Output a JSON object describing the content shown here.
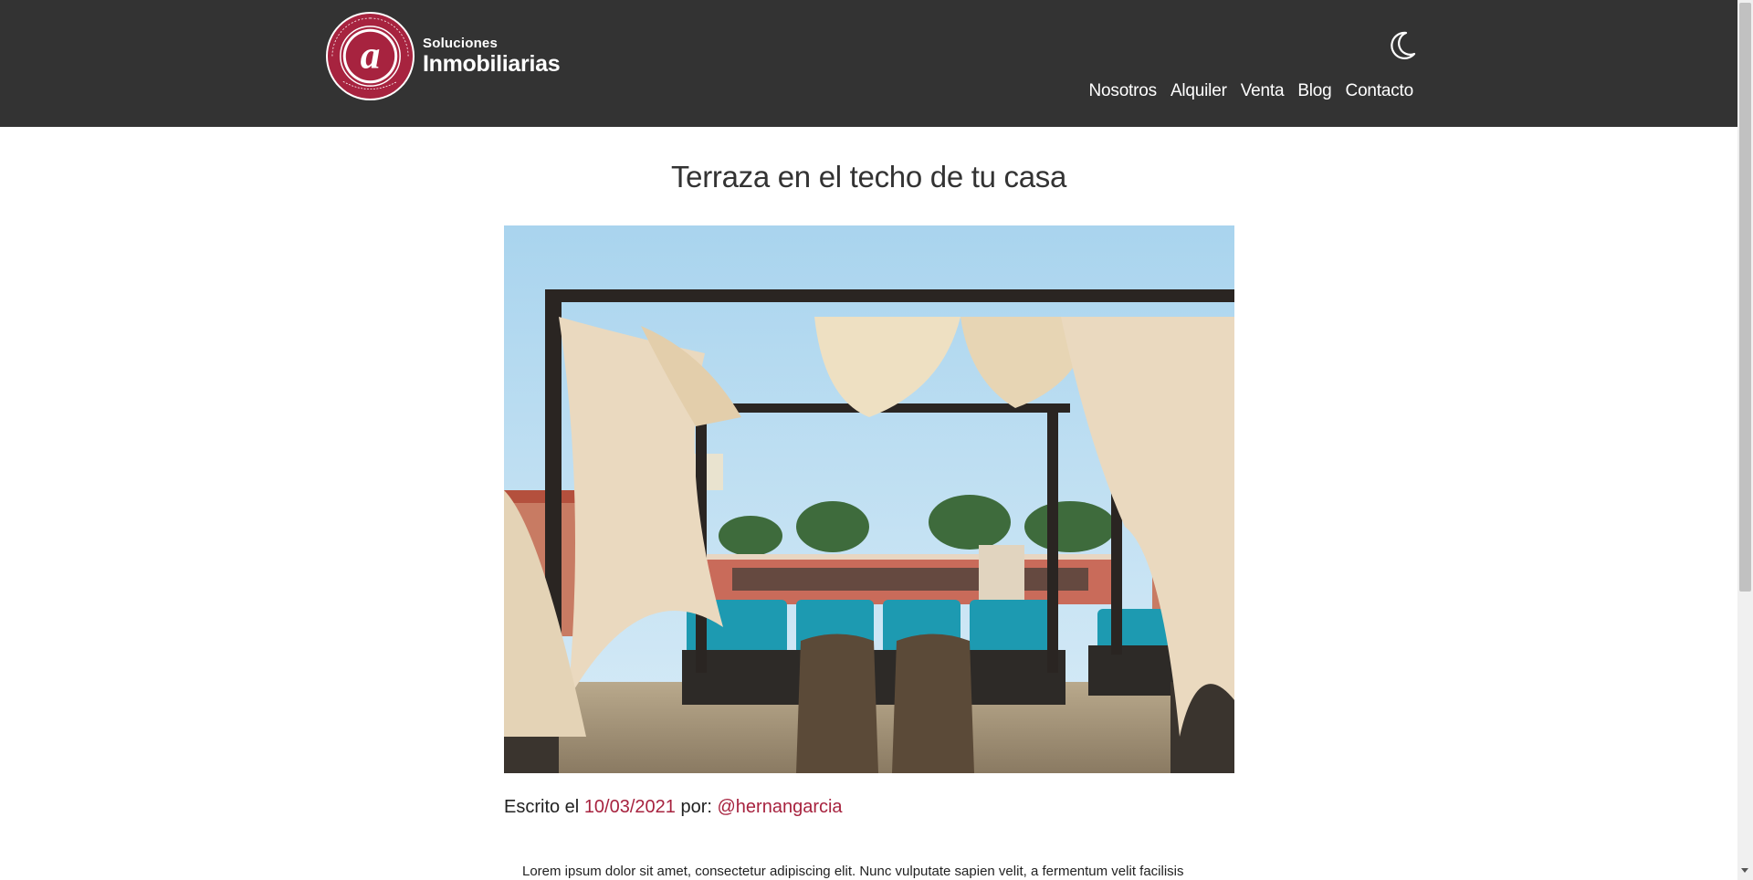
{
  "header": {
    "logo": {
      "small_text": "Soluciones",
      "big_text": "Inmobiliarias",
      "seal_letter": "a",
      "seal_ring_text": "SOLUCIONES INMOBILIARIAS",
      "seal_bottom_text": "ateneo",
      "brand_color": "#a7233f"
    },
    "theme_toggle_icon": "moon-icon",
    "nav": [
      {
        "label": "Nosotros"
      },
      {
        "label": "Alquiler"
      },
      {
        "label": "Venta"
      },
      {
        "label": "Blog"
      },
      {
        "label": "Contacto"
      }
    ]
  },
  "post": {
    "title": "Terraza en el techo de tu casa",
    "meta": {
      "written_prefix": "Escrito el ",
      "date": "10/03/2021",
      "by_prefix": " por: ",
      "author": "@hernangarcia"
    },
    "body_first_line": "Lorem ipsum dolor sit amet, consectetur adipiscing elit. Nunc vulputate sapien velit, a fermentum velit facilisis"
  },
  "colors": {
    "header_bg": "#333333",
    "accent": "#a7233f"
  }
}
